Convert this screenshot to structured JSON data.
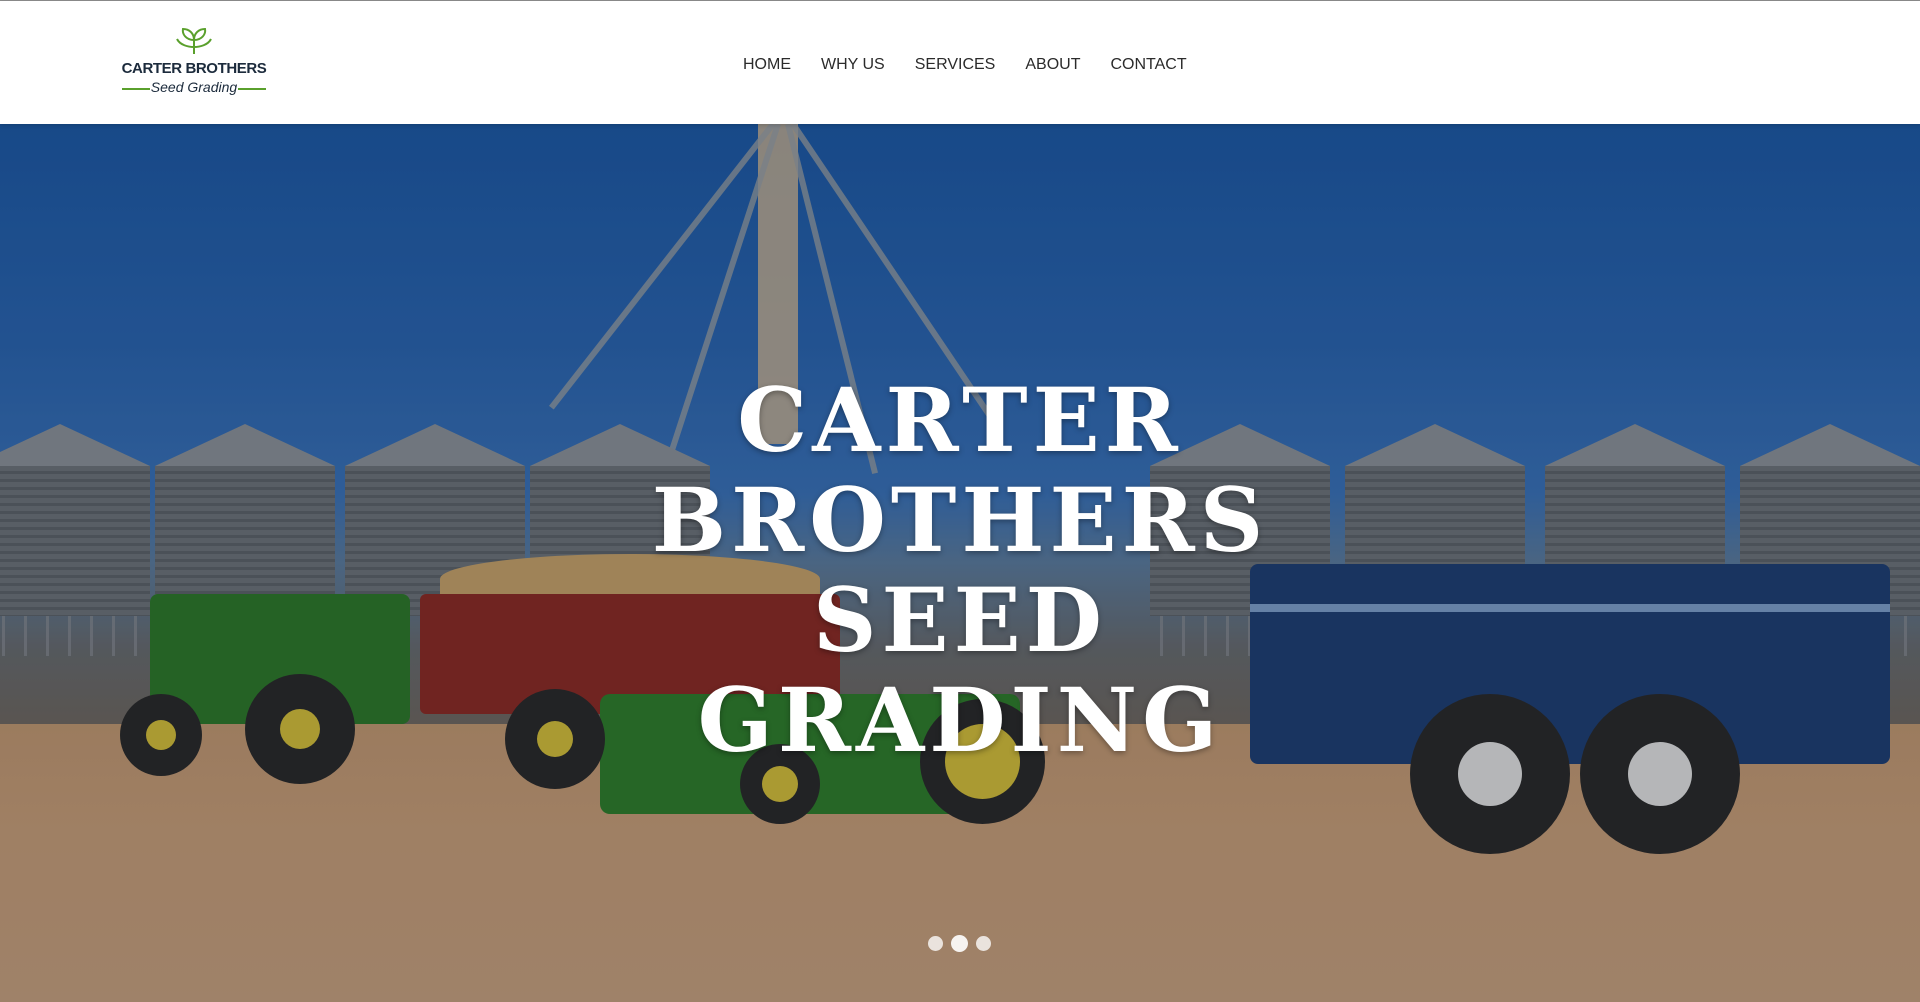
{
  "brand": {
    "line1": "CARTER BROTHERS",
    "line2": "Seed Grading",
    "accent_color": "#5aa02c",
    "text_color": "#1c2b3c"
  },
  "nav": {
    "items": [
      {
        "label": "HOME"
      },
      {
        "label": "WHY US"
      },
      {
        "label": "SERVICES"
      },
      {
        "label": "ABOUT"
      },
      {
        "label": "CONTACT"
      }
    ]
  },
  "hero": {
    "title_lines": [
      "CARTER",
      "BROTHERS",
      "SEED",
      "GRADING"
    ],
    "image_description_icon": "farm-machinery-photo",
    "slider": {
      "slide_count": 3,
      "active_index": 1
    }
  },
  "icons": {
    "logo": "leaf-sprout-icon"
  }
}
